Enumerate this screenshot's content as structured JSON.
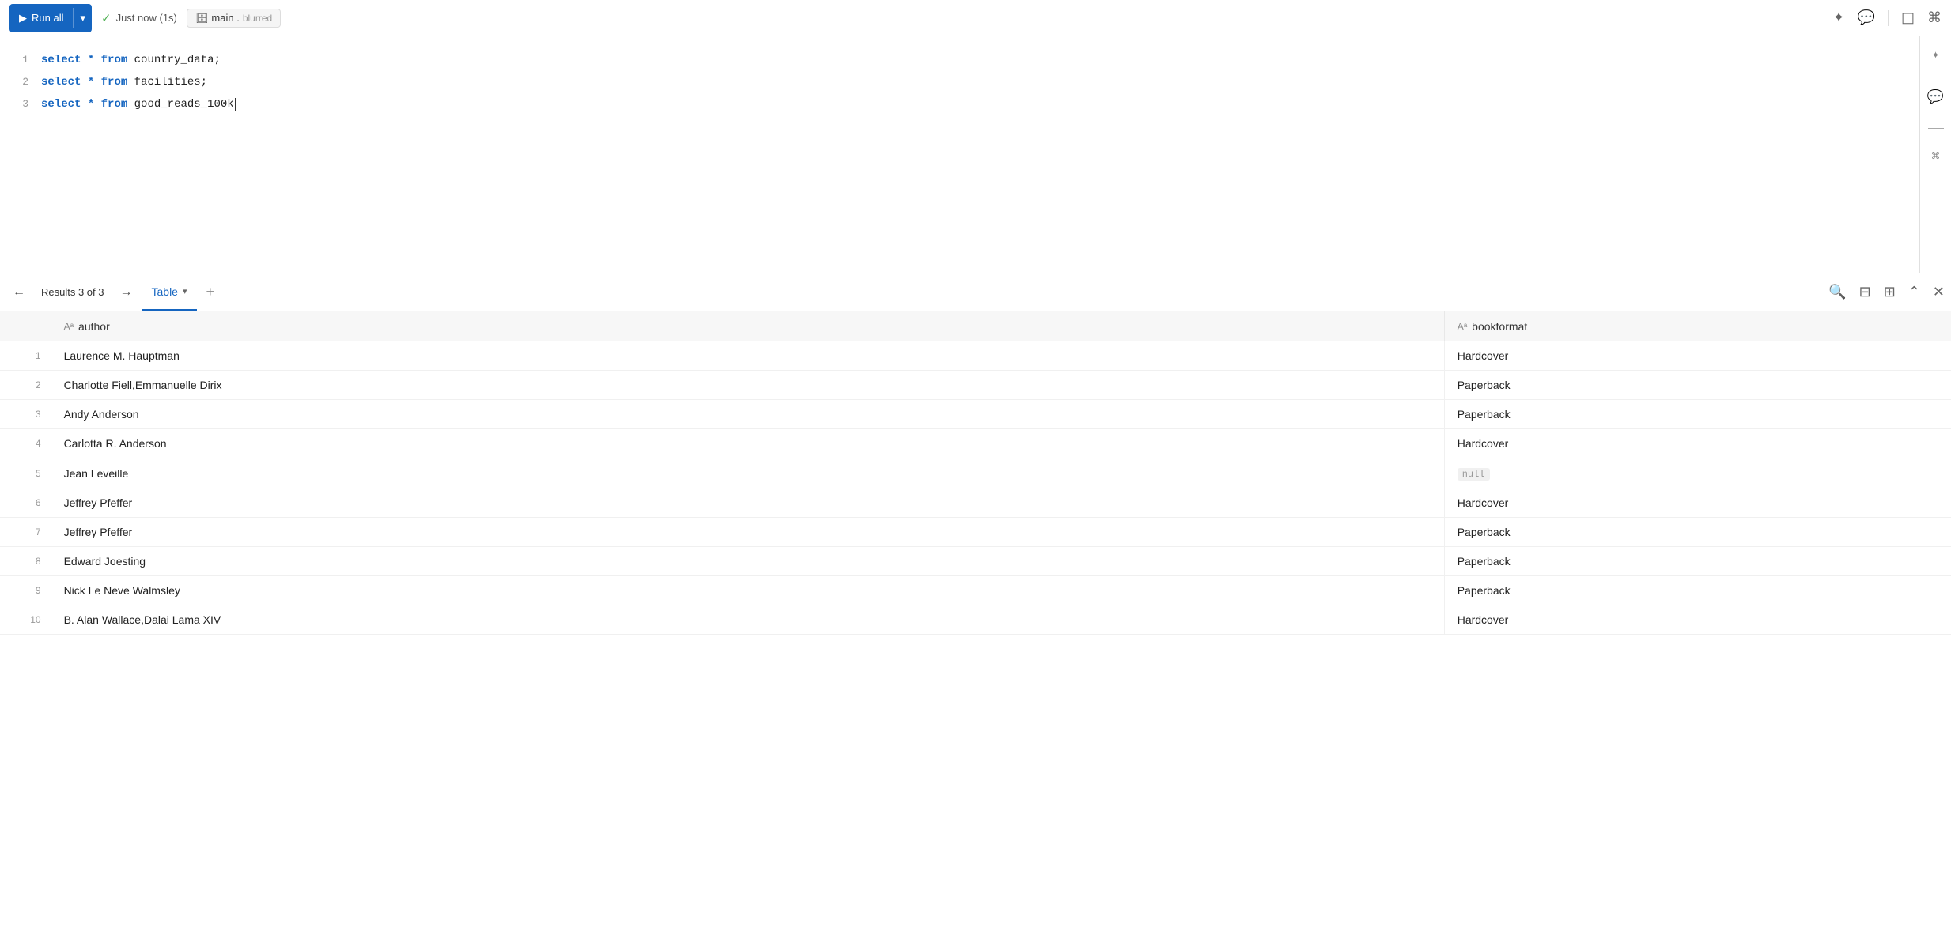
{
  "toolbar": {
    "run_all_label": "Run all",
    "run_icon": "▶",
    "dropdown_icon": "▾",
    "check_icon": "✓",
    "status_label": "Just now (1s)",
    "db_icon": "⊞",
    "db_name": "main .",
    "pin_icon": "✦",
    "chat_icon": "💬",
    "panel_icon": "◫",
    "cmd_icon": "⌘"
  },
  "editor": {
    "lines": [
      {
        "num": "1",
        "code": "select * from country_data;"
      },
      {
        "num": "2",
        "code": "select * from facilities;"
      },
      {
        "num": "3",
        "code": "select * from good_reads_100k"
      }
    ]
  },
  "results": {
    "label": "Results 3 of 3",
    "prev_icon": "←",
    "next_icon": "→",
    "tab_table": "Table",
    "tab_dropdown_icon": "▾",
    "tab_add_icon": "+",
    "search_icon": "🔍",
    "filter_icon": "⊟",
    "columns_icon": "⊞",
    "expand_icon": "⌃",
    "close_icon": "✕"
  },
  "table": {
    "columns": [
      {
        "id": "author",
        "label": "author",
        "type_icon": "Aᵃ"
      },
      {
        "id": "bookformat",
        "label": "bookformat",
        "type_icon": "Aᵃ"
      }
    ],
    "rows": [
      {
        "num": 1,
        "author": "Laurence M. Hauptman",
        "bookformat": "Hardcover"
      },
      {
        "num": 2,
        "author": "Charlotte Fiell,Emmanuelle Dirix",
        "bookformat": "Paperback"
      },
      {
        "num": 3,
        "author": "Andy Anderson",
        "bookformat": "Paperback"
      },
      {
        "num": 4,
        "author": "Carlotta R. Anderson",
        "bookformat": "Hardcover"
      },
      {
        "num": 5,
        "author": "Jean Leveille",
        "bookformat": null
      },
      {
        "num": 6,
        "author": "Jeffrey Pfeffer",
        "bookformat": "Hardcover"
      },
      {
        "num": 7,
        "author": "Jeffrey Pfeffer",
        "bookformat": "Paperback"
      },
      {
        "num": 8,
        "author": "Edward Joesting",
        "bookformat": "Paperback"
      },
      {
        "num": 9,
        "author": "Nick Le Neve Walmsley",
        "bookformat": "Paperback"
      },
      {
        "num": 10,
        "author": "B. Alan Wallace,Dalai Lama XIV",
        "bookformat": "Hardcover"
      }
    ]
  }
}
